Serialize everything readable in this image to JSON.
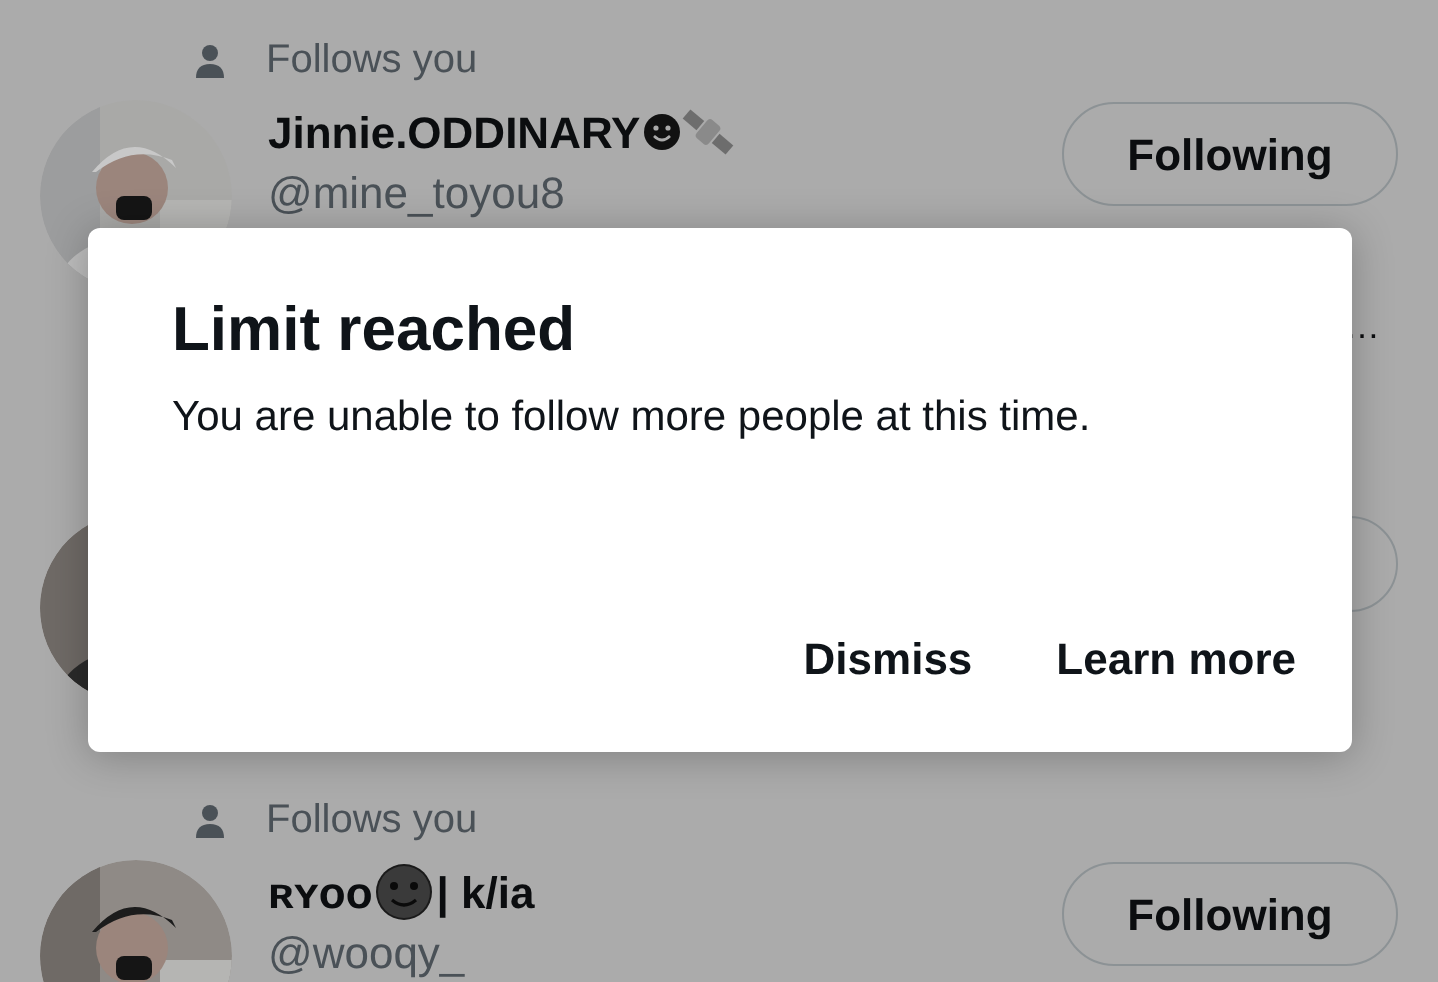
{
  "rows": [
    {
      "follows_you": "Follows you",
      "name_parts": [
        {
          "kind": "text",
          "text": "Jinnie.ODDINARY"
        },
        {
          "kind": "smiley"
        },
        {
          "kind": "satellite"
        }
      ],
      "handle": "@mine_toyou8",
      "button": "Following",
      "bio": "…"
    },
    {
      "button": ""
    },
    {
      "follows_you": "Follows you",
      "name_parts": [
        {
          "kind": "text",
          "text": "ʀʏᴏᴏ"
        },
        {
          "kind": "moon-face"
        },
        {
          "kind": "text",
          "text": "| k/ia"
        }
      ],
      "handle": "@wooqy_",
      "button": "Following"
    }
  ],
  "dialog": {
    "title": "Limit reached",
    "message": "You are unable to follow more people at this time.",
    "buttons": [
      "Dismiss",
      "Learn more"
    ]
  }
}
